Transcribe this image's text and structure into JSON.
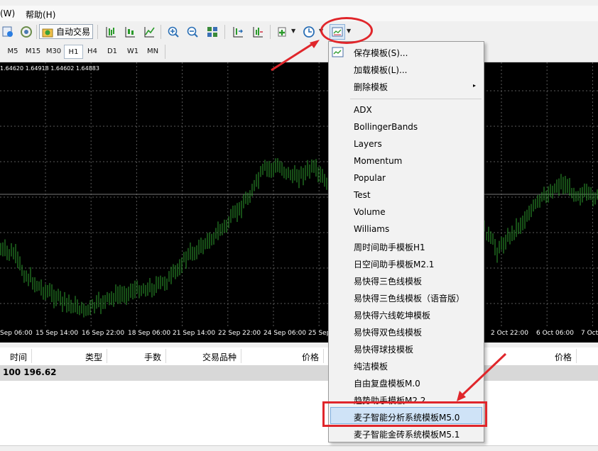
{
  "menu": {
    "items": [
      {
        "label": "(W)"
      },
      {
        "label": "帮助(H)"
      }
    ]
  },
  "toolbar": {
    "autotrade_label": "自动交易",
    "icons": [
      "history-center-icon",
      "signal-icon",
      "auto-trade-icon",
      "bar-chart-icon",
      "candlestick-icon",
      "line-chart-icon",
      "zoom-in-icon",
      "zoom-out-icon",
      "tile-windows-icon",
      "chart-shift-icon",
      "autoscroll-icon",
      "indicators-icon",
      "periods-clock-icon",
      "templates-icon"
    ]
  },
  "periods": {
    "items": [
      "M5",
      "M15",
      "M30",
      "H1",
      "H4",
      "D1",
      "W1",
      "MN"
    ],
    "active": "H1"
  },
  "chart": {
    "ohlc": "1.64620 1.64918 1.64602 1.64883",
    "time_labels": [
      "Sep 06:00",
      "15 Sep 14:00",
      "16 Sep 22:00",
      "18 Sep 06:00",
      "21 Sep 14:00",
      "22 Sep 22:00",
      "24 Sep 06:00",
      "25 Sep",
      "2 Oct 22:00",
      "6 Oct 06:00",
      "7 Oct"
    ],
    "colors": {
      "background": "#000000",
      "candles": "#2e9e2e",
      "grid": "#5a5a5a"
    },
    "grid_style": "dotted",
    "horizontal_line": true
  },
  "terminal": {
    "headers": [
      "时间",
      "类型",
      "手数",
      "交易品种",
      "价格",
      "价格"
    ],
    "balance": "100 196.62"
  },
  "dropdown": {
    "top_items": [
      {
        "label": "保存模板(S)..."
      },
      {
        "label": "加载模板(L)..."
      },
      {
        "label": "删除模板",
        "submenu": "▸"
      }
    ],
    "templates": [
      "ADX",
      "BollingerBands",
      "Layers",
      "Momentum",
      "Popular",
      "Test",
      "Volume",
      "Williams",
      "周时间助手模板H1",
      "日空间助手模板M2.1",
      "易快得三色线模板",
      "易快得三色线模板（语音版）",
      "易快得六线乾坤模板",
      "易快得双色线模板",
      "易快得球技模板",
      "纯洁模板",
      "自由复盘模板M.0",
      "趋势助手模板M2.2",
      "麦子智能分析系统模板M5.0",
      "麦子智能金砖系统模板M5.1"
    ],
    "highlighted": "麦子智能分析系统模板M5.0",
    "colors": {
      "highlight": "#cfe3f7",
      "annotation": "#e0262b"
    }
  }
}
